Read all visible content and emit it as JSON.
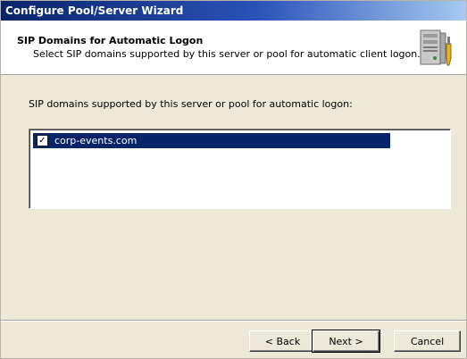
{
  "window": {
    "title": "Configure Pool/Server Wizard"
  },
  "header": {
    "title": "SIP Domains for Automatic Logon",
    "subtitle": "Select SIP domains supported by this server or pool for automatic client logon.",
    "icon": "server-tools-icon"
  },
  "content": {
    "label": "SIP domains supported by this server or pool for automatic logon:",
    "domains": [
      {
        "name": "corp-events.com",
        "checked": true,
        "selected": true
      }
    ]
  },
  "buttons": {
    "back": "< Back",
    "next": "Next >",
    "cancel": "Cancel"
  },
  "colors": {
    "selection": "#0a246a",
    "dialog_bg": "#ece9d8",
    "titlebar": "#0a246a"
  }
}
